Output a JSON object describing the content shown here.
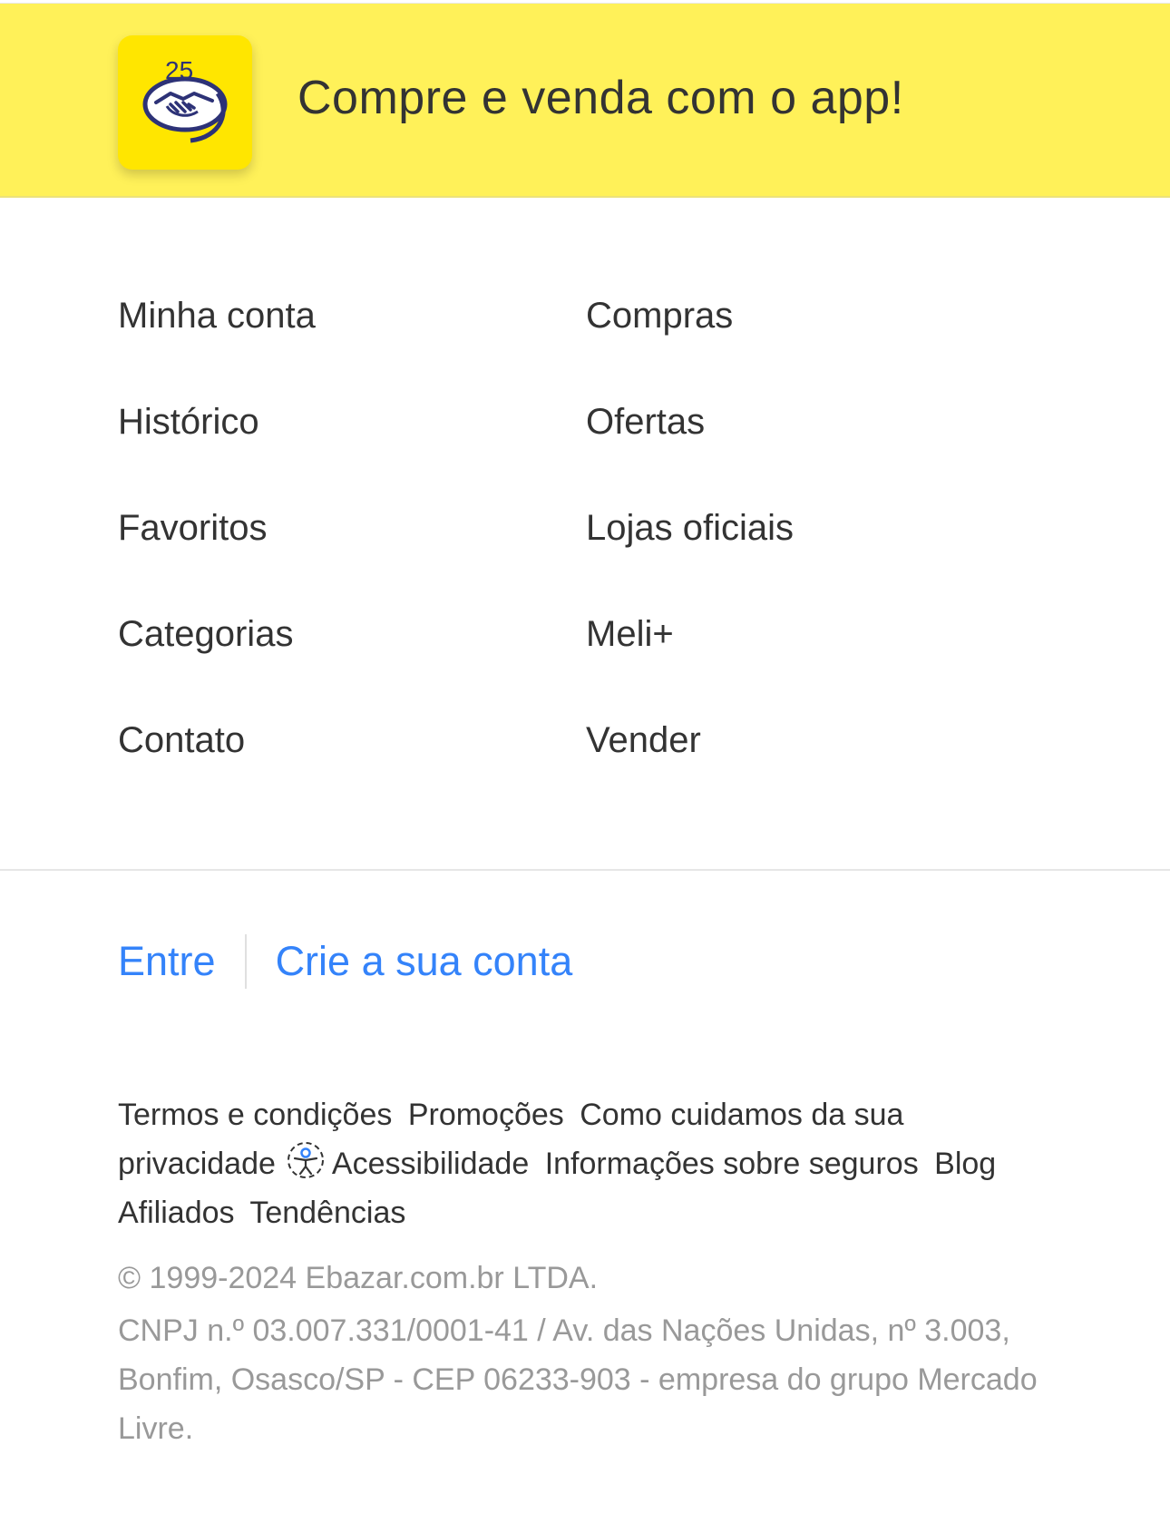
{
  "banner": {
    "text": "Compre e venda com o app!",
    "logo_icon": "mercado-livre-25-handshake-icon"
  },
  "nav": {
    "left": [
      "Minha conta",
      "Histórico",
      "Favoritos",
      "Categorias",
      "Contato"
    ],
    "right": [
      "Compras",
      "Ofertas",
      "Lojas oficiais",
      "Meli+",
      "Vender"
    ]
  },
  "auth": {
    "login": "Entre",
    "signup": "Crie a sua conta"
  },
  "legal": {
    "links": [
      "Termos e condições",
      "Promoções",
      "Como cuidamos da sua privacidade",
      "Acessibilidade",
      "Informações sobre seguros",
      "Blog",
      "Afiliados",
      "Tendências"
    ],
    "accessibility_icon": "accessibility-icon"
  },
  "footer": {
    "copyright": "© 1999-2024 Ebazar.com.br LTDA.",
    "company_info": "CNPJ n.º 03.007.331/0001-41 / Av. das Nações Unidas, nº 3.003, Bonfim, Osasco/SP - CEP 06233-903 - empresa do grupo Mercado Livre."
  },
  "colors": {
    "banner_bg": "#fff159",
    "logo_bg": "#ffe600",
    "link_blue": "#3483fa",
    "muted_text": "#999999"
  }
}
